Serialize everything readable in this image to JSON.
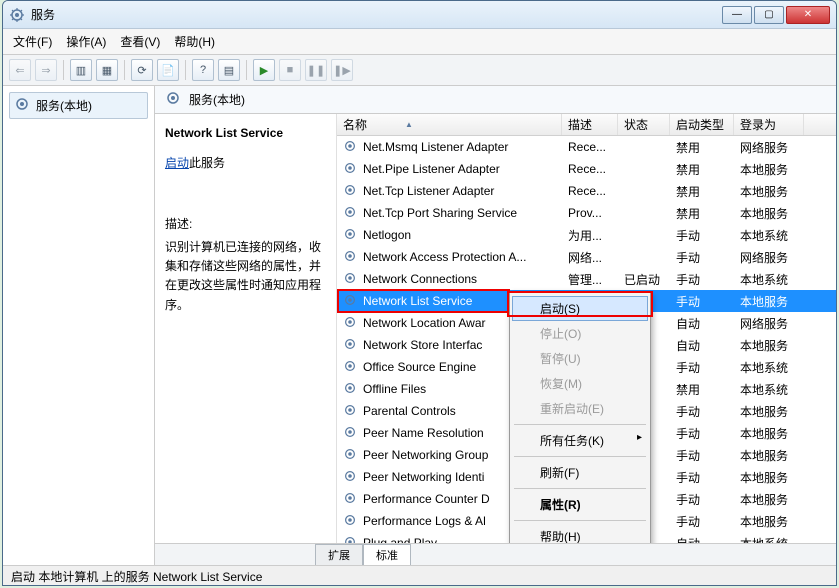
{
  "window": {
    "title": "服务"
  },
  "menubar": [
    "文件(F)",
    "操作(A)",
    "查看(V)",
    "帮助(H)"
  ],
  "nav": {
    "item": "服务(本地)"
  },
  "main_header": "服务(本地)",
  "detail": {
    "title": "Network List Service",
    "start_link_text": "启动",
    "start_suffix": "此服务",
    "desc_label": "描述:",
    "description": "识别计算机已连接的网络，收集和存储这些网络的属性，并在更改这些属性时通知应用程序。"
  },
  "columns": {
    "name": "名称",
    "desc": "描述",
    "status": "状态",
    "startup": "启动类型",
    "logon": "登录为"
  },
  "services": [
    {
      "name": "Net.Msmq Listener Adapter",
      "desc": "Rece...",
      "status": "",
      "startup": "禁用",
      "logon": "网络服务"
    },
    {
      "name": "Net.Pipe Listener Adapter",
      "desc": "Rece...",
      "status": "",
      "startup": "禁用",
      "logon": "本地服务"
    },
    {
      "name": "Net.Tcp Listener Adapter",
      "desc": "Rece...",
      "status": "",
      "startup": "禁用",
      "logon": "本地服务"
    },
    {
      "name": "Net.Tcp Port Sharing Service",
      "desc": "Prov...",
      "status": "",
      "startup": "禁用",
      "logon": "本地服务"
    },
    {
      "name": "Netlogon",
      "desc": "为用...",
      "status": "",
      "startup": "手动",
      "logon": "本地系统"
    },
    {
      "name": "Network Access Protection A...",
      "desc": "网络...",
      "status": "",
      "startup": "手动",
      "logon": "网络服务"
    },
    {
      "name": "Network Connections",
      "desc": "管理...",
      "status": "已启动",
      "startup": "手动",
      "logon": "本地系统"
    },
    {
      "name": "Network List Service",
      "desc": "",
      "status": "",
      "startup": "手动",
      "logon": "本地服务",
      "selected": true
    },
    {
      "name": "Network Location Awar",
      "desc": "",
      "status": "",
      "startup": "自动",
      "logon": "网络服务"
    },
    {
      "name": "Network Store Interfac",
      "desc": "",
      "status": "",
      "startup": "自动",
      "logon": "本地服务"
    },
    {
      "name": "Office Source Engine",
      "desc": "",
      "status": "",
      "startup": "手动",
      "logon": "本地系统"
    },
    {
      "name": "Offline Files",
      "desc": "",
      "status": "",
      "startup": "禁用",
      "logon": "本地系统"
    },
    {
      "name": "Parental Controls",
      "desc": "",
      "status": "",
      "startup": "手动",
      "logon": "本地服务"
    },
    {
      "name": "Peer Name Resolution",
      "desc": "",
      "status": "",
      "startup": "手动",
      "logon": "本地服务"
    },
    {
      "name": "Peer Networking Group",
      "desc": "",
      "status": "",
      "startup": "手动",
      "logon": "本地服务"
    },
    {
      "name": "Peer Networking Identi",
      "desc": "",
      "status": "",
      "startup": "手动",
      "logon": "本地服务"
    },
    {
      "name": "Performance Counter D",
      "desc": "",
      "status": "",
      "startup": "手动",
      "logon": "本地服务"
    },
    {
      "name": "Performance Logs & Al",
      "desc": "",
      "status": "",
      "startup": "手动",
      "logon": "本地服务"
    },
    {
      "name": "Plug and Play",
      "desc": "",
      "status": "",
      "startup": "自动",
      "logon": "本地系统"
    }
  ],
  "context_menu": [
    {
      "label": "启动(S)",
      "enabled": true,
      "hover": true
    },
    {
      "label": "停止(O)",
      "enabled": false
    },
    {
      "label": "暂停(U)",
      "enabled": false
    },
    {
      "label": "恢复(M)",
      "enabled": false
    },
    {
      "label": "重新启动(E)",
      "enabled": false
    },
    {
      "sep": true
    },
    {
      "label": "所有任务(K)",
      "enabled": true,
      "sub": true
    },
    {
      "sep": true
    },
    {
      "label": "刷新(F)",
      "enabled": true
    },
    {
      "sep": true
    },
    {
      "label": "属性(R)",
      "enabled": true,
      "bold": true
    },
    {
      "sep": true
    },
    {
      "label": "帮助(H)",
      "enabled": true
    }
  ],
  "tabs": {
    "extended": "扩展",
    "standard": "标准"
  },
  "statusbar": "启动 本地计算机 上的服务 Network List Service"
}
